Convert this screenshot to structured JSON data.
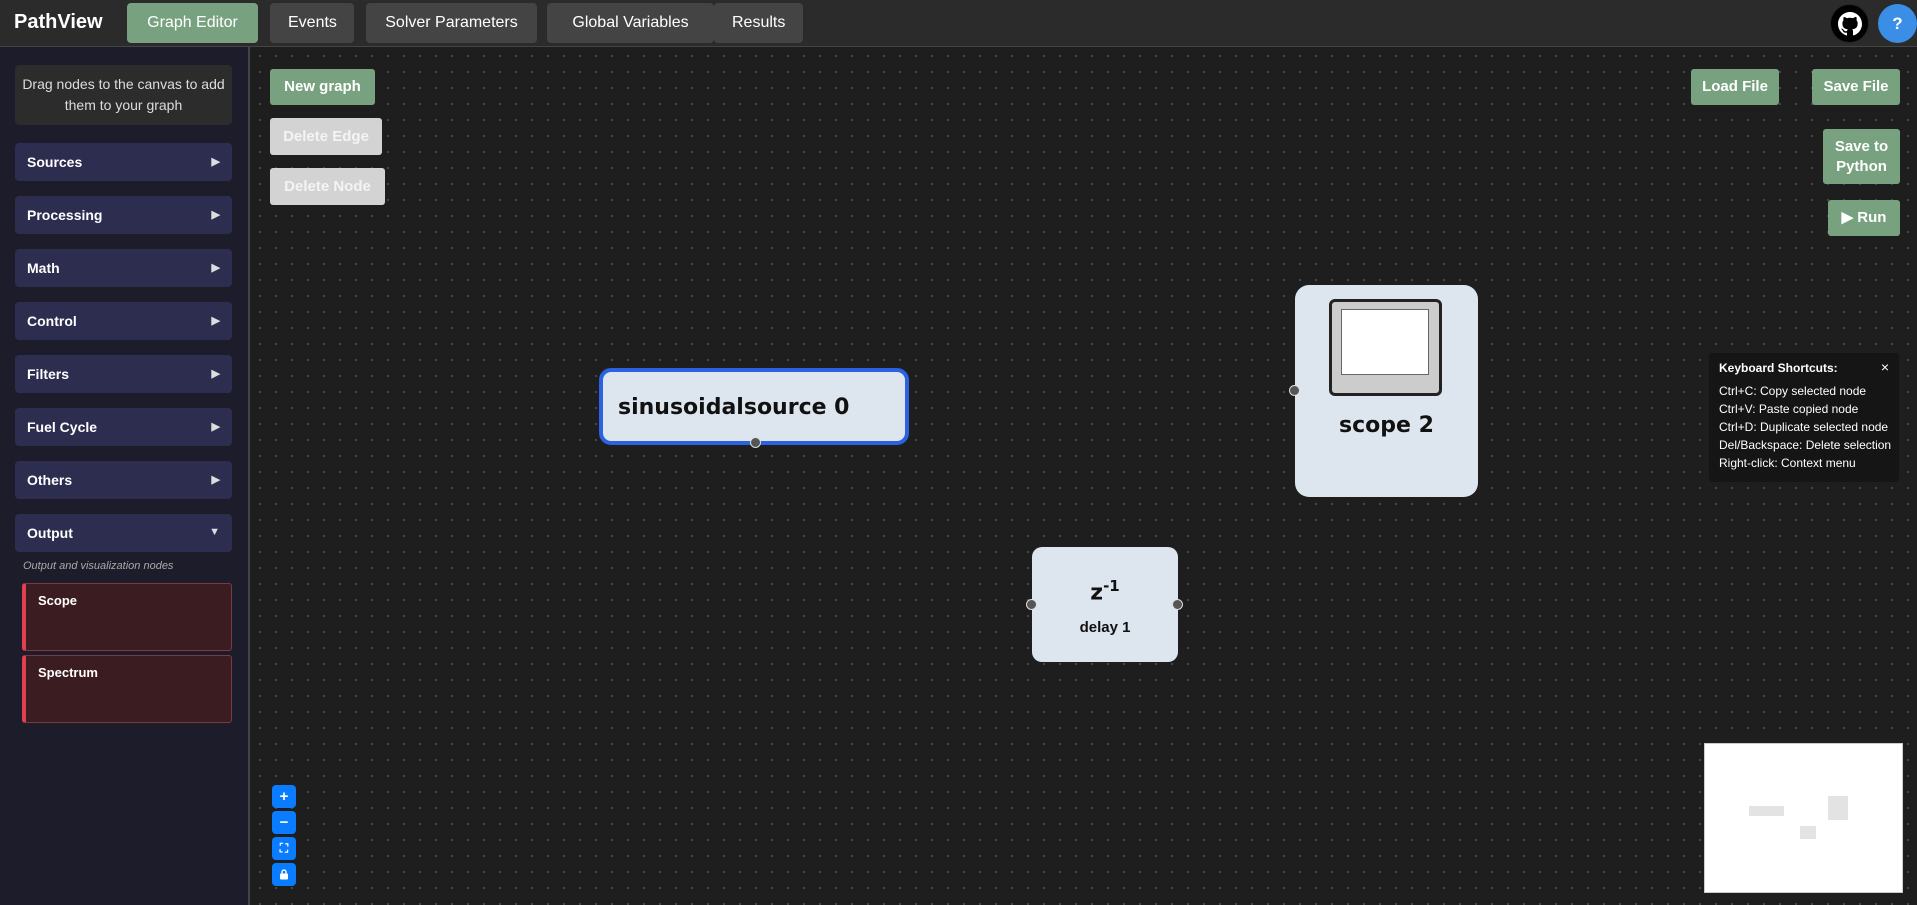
{
  "app": {
    "title": "PathView"
  },
  "tabs": [
    {
      "label": "Graph Editor",
      "active": true
    },
    {
      "label": "Events",
      "active": false
    },
    {
      "label": "Solver Parameters",
      "active": false
    },
    {
      "label": "Global Variables",
      "active": false
    },
    {
      "label": "Results",
      "active": false
    }
  ],
  "header_icons": {
    "github": "github-icon",
    "help": "?"
  },
  "sidebar": {
    "hint": "Drag nodes to the canvas to add them to your graph",
    "categories": [
      {
        "label": "Sources",
        "expanded": false
      },
      {
        "label": "Processing",
        "expanded": false
      },
      {
        "label": "Math",
        "expanded": false
      },
      {
        "label": "Control",
        "expanded": false
      },
      {
        "label": "Filters",
        "expanded": false
      },
      {
        "label": "Fuel Cycle",
        "expanded": false
      },
      {
        "label": "Others",
        "expanded": false
      },
      {
        "label": "Output",
        "expanded": true
      }
    ],
    "collapsed_arrow": "▶",
    "expanded_arrow": "▼",
    "output_description": "Output and visualization nodes",
    "output_nodes": [
      "Scope",
      "Spectrum"
    ]
  },
  "toolbar": {
    "new_graph": "New graph",
    "delete_edge": "Delete Edge",
    "delete_node": "Delete Node",
    "load_file": "Load File",
    "save_file": "Save File",
    "save_python": "Save to Python",
    "run": "▶ Run"
  },
  "nodes": {
    "sine": {
      "label": "sinusoidalsource 0"
    },
    "scope": {
      "label": "scope 2"
    },
    "delay": {
      "symbol": "z",
      "exponent": "-1",
      "label": "delay 1"
    }
  },
  "shortcuts": {
    "title": "Keyboard Shortcuts:",
    "close": "×",
    "lines": [
      "Ctrl+C: Copy selected node",
      "Ctrl+V: Paste copied node",
      "Ctrl+D: Duplicate selected node",
      "Del/Backspace: Delete selection",
      "Right-click: Context menu"
    ]
  },
  "zoom_controls": {
    "zoom_in": "+",
    "zoom_out": "−",
    "fit_view": "⛶",
    "lock": "🔒"
  },
  "colors": {
    "accent": "#78a27f",
    "selected": "#2a62e0",
    "zoom": "#0a7cff",
    "output_border": "#e04050"
  }
}
